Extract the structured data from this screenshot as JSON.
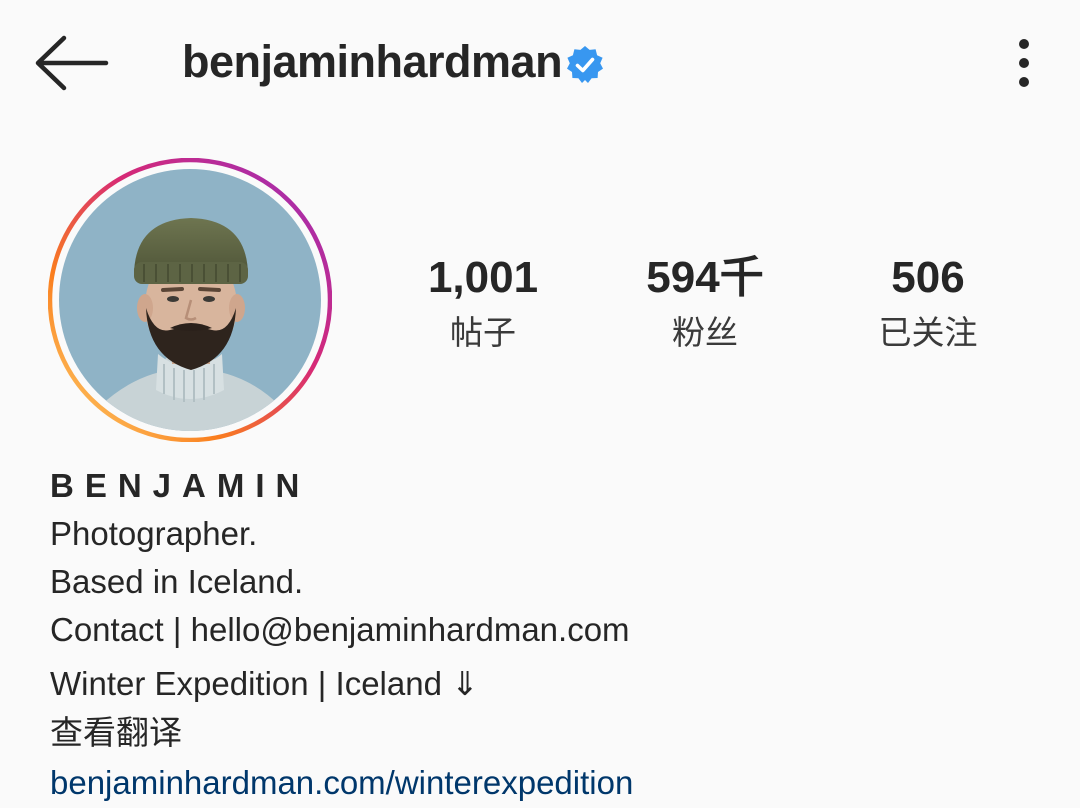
{
  "header": {
    "username": "benjaminhardman"
  },
  "stats": [
    {
      "value": "1,001",
      "label": "帖子"
    },
    {
      "value": "594千",
      "label": "粉丝"
    },
    {
      "value": "506",
      "label": "已关注"
    }
  ],
  "bio": {
    "name": "BENJAMIN",
    "lines": [
      "Photographer.",
      "Based in Iceland.",
      "Contact | hello@benjaminhardman.com",
      "Winter Expedition | Iceland ⇓"
    ],
    "translate_label": "查看翻译",
    "link": "benjaminhardman.com/winterexpedition"
  },
  "colors": {
    "verified": "#3897f0",
    "link": "#00376b",
    "background": "#fafafa"
  },
  "icons": [
    "back-arrow-icon",
    "verified-badge-icon",
    "more-options-icon"
  ]
}
